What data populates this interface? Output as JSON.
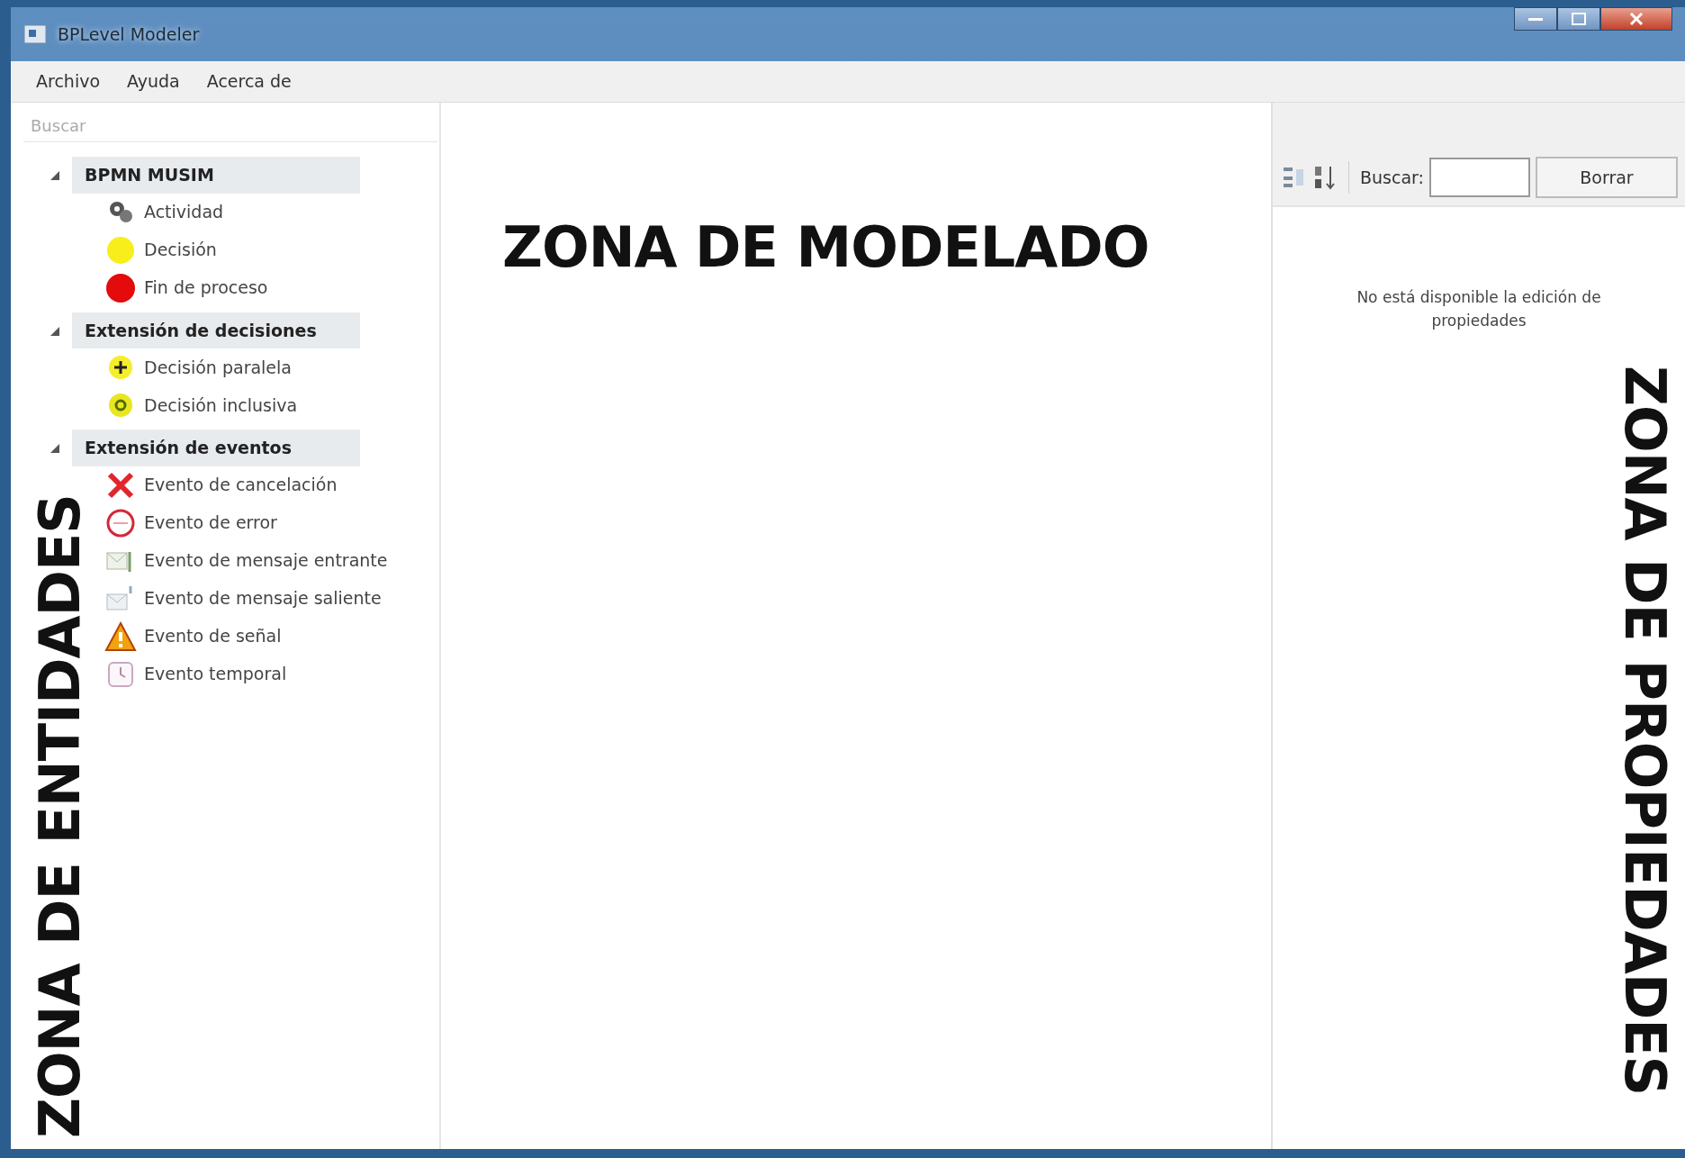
{
  "window": {
    "title": "BPLevel Modeler"
  },
  "menu": [
    "Archivo",
    "Ayuda",
    "Acerca de"
  ],
  "entities": {
    "search": {
      "placeholder": "Buscar"
    },
    "groups": [
      {
        "label": "BPMN MUSIM",
        "expanded": true,
        "children": [
          {
            "label": "Actividad",
            "kind": "activity"
          },
          {
            "label": "Decisión",
            "kind": "gateway"
          },
          {
            "label": "Fin de proceso",
            "kind": "end"
          }
        ]
      },
      {
        "label": "Extensión de decisiones",
        "expanded": true,
        "children": [
          {
            "label": "Decisión paralela",
            "kind": "parallel"
          },
          {
            "label": "Decisión inclusiva",
            "kind": "inclusive"
          }
        ]
      },
      {
        "label": "Extensión de eventos",
        "expanded": true,
        "children": [
          {
            "label": "Evento de cancelación",
            "kind": "cancel"
          },
          {
            "label": "Evento de error",
            "kind": "error"
          },
          {
            "label": "Evento de mensaje entrante",
            "kind": "incoming"
          },
          {
            "label": "Evento de mensaje saliente",
            "kind": "outgoing"
          },
          {
            "label": "Evento de señal",
            "kind": "signal"
          },
          {
            "label": "Evento temporal",
            "kind": "timer"
          }
        ]
      }
    ],
    "zone_label": "ZONA DE ENTIDADES"
  },
  "canvas": {
    "zone_label": "ZONA DE MODELADO"
  },
  "properties": {
    "search_label": "Buscar:",
    "clear_button": "Borrar",
    "message": "No está disponible la edición de propiedades",
    "zone_label": "ZONA DE PROPIEDADES"
  }
}
